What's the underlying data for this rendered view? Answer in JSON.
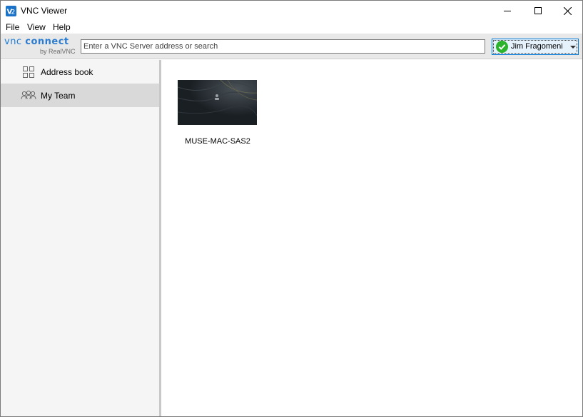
{
  "window": {
    "title": "VNC Viewer",
    "controls": {
      "minimize": "–",
      "maximize": "□",
      "close": "✕"
    }
  },
  "menu": [
    "File",
    "View",
    "Help"
  ],
  "toolbar": {
    "logo_vnc": "vnc",
    "logo_connect": "connect",
    "logo_sub": "by RealVNC",
    "search_placeholder": "Enter a VNC Server address or search",
    "search_value": "",
    "user_name": "Jim Fragomeni",
    "user_status_color": "#2bb32b"
  },
  "sidebar": {
    "items": [
      {
        "label": "Address book",
        "icon": "address-book-grid-icon",
        "selected": false
      },
      {
        "label": "My Team",
        "icon": "team-people-icon",
        "selected": true
      }
    ]
  },
  "main": {
    "computers": [
      {
        "name": "MUSE-MAC-SAS2",
        "thumbnail": "dark-wallpaper-with-user-silhouette"
      }
    ]
  },
  "colors": {
    "accent": "#1e7bd6",
    "selected_bg": "#d9d9d9",
    "sidebar_bg": "#f5f5f5",
    "toolbar_bg": "#e8e8e8"
  }
}
